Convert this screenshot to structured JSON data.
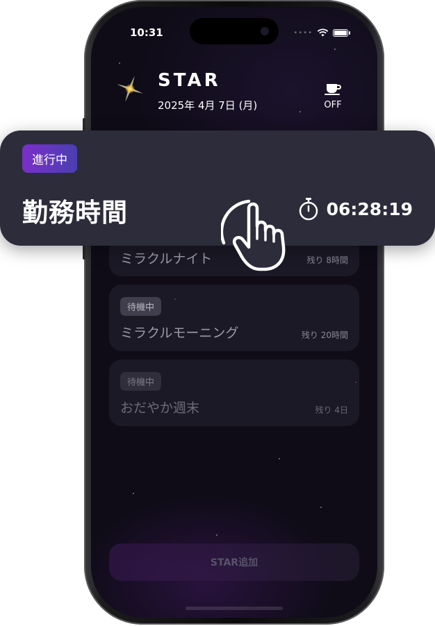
{
  "status_bar": {
    "time": "10:31",
    "signal_icon": "cellular-dots-icon",
    "wifi_icon": "wifi-icon",
    "battery_icon": "battery-icon"
  },
  "header": {
    "app_name": "STAR",
    "date": "2025年 4月 7日 (月)",
    "logo_icon": "sparkle-star-icon",
    "break_toggle": {
      "icon": "coffee-cup-icon",
      "label": "OFF"
    }
  },
  "active_card": {
    "badge": "進行中",
    "title": "勤務時間",
    "timer_icon": "stopwatch-icon",
    "elapsed": "06:28:19"
  },
  "cards": [
    {
      "badge": "",
      "title": "ミラクルナイト",
      "remaining": "残り 8時間"
    },
    {
      "badge": "待機中",
      "title": "ミラクルモーニング",
      "remaining": "残り 20時間"
    },
    {
      "badge": "待機中",
      "title": "おだやか週末",
      "remaining": "残り 4日"
    }
  ],
  "add_button": {
    "label": "STAR追加"
  },
  "gesture": {
    "icon": "tap-hand-icon"
  },
  "colors": {
    "accent_from": "#7a2fc9",
    "accent_to": "#4a3fb0",
    "background": "#0f0c18",
    "overlay": "#2d2c3a"
  }
}
